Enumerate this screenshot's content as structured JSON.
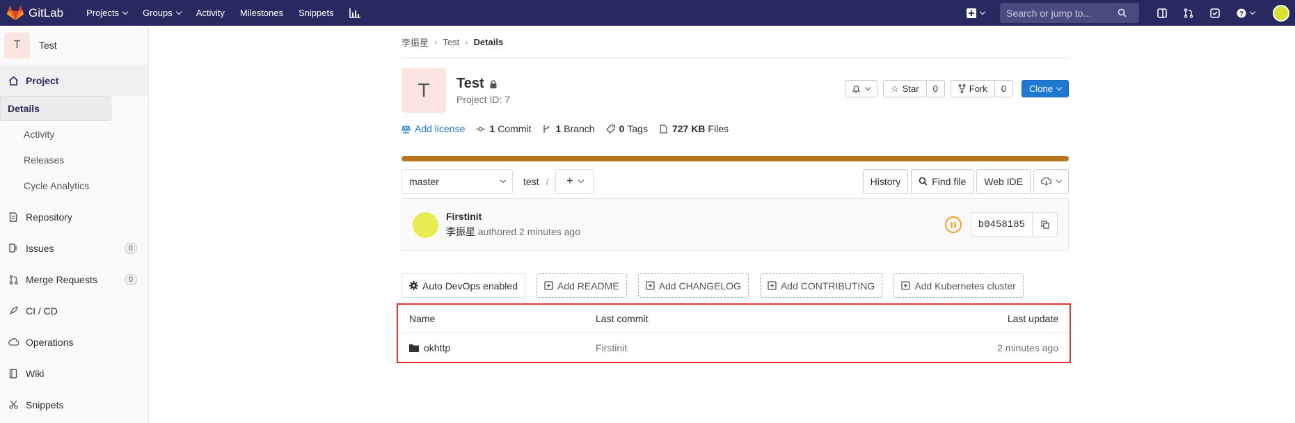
{
  "topbar": {
    "brand": "GitLab",
    "nav": [
      {
        "label": "Projects",
        "caret": true
      },
      {
        "label": "Groups",
        "caret": true
      },
      {
        "label": "Activity",
        "caret": false
      },
      {
        "label": "Milestones",
        "caret": false
      },
      {
        "label": "Snippets",
        "caret": false
      }
    ],
    "search_placeholder": "Search or jump to...",
    "colors": {
      "bg": "#292961"
    }
  },
  "sidebar": {
    "project_initial": "T",
    "project_name": "Test",
    "project_label": "Project",
    "sub_items": [
      "Details",
      "Activity",
      "Releases",
      "Cycle Analytics"
    ],
    "items": [
      {
        "label": "Repository",
        "icon": "repository-icon"
      },
      {
        "label": "Issues",
        "icon": "issues-icon",
        "count": "0"
      },
      {
        "label": "Merge Requests",
        "icon": "merge-request-icon",
        "count": "0"
      },
      {
        "label": "CI / CD",
        "icon": "rocket-icon"
      },
      {
        "label": "Operations",
        "icon": "cloud-gear-icon"
      },
      {
        "label": "Wiki",
        "icon": "book-icon"
      },
      {
        "label": "Snippets",
        "icon": "scissors-icon"
      }
    ]
  },
  "breadcrumb": {
    "owner": "李振星",
    "project": "Test",
    "current": "Details"
  },
  "project": {
    "initial": "T",
    "name": "Test",
    "id_text": "Project ID: 7",
    "star_label": "Star",
    "star_count": "0",
    "fork_label": "Fork",
    "fork_count": "0",
    "clone_label": "Clone"
  },
  "stats": {
    "add_license": "Add license",
    "commits_n": "1",
    "commits_label": "Commit",
    "branches_n": "1",
    "branches_label": "Branch",
    "tags_n": "0",
    "tags_label": "Tags",
    "files_size": "727 KB",
    "files_label": "Files",
    "language_bar_color": "#b8761d"
  },
  "toolbar": {
    "branch": "master",
    "path": "test",
    "history": "History",
    "find_file": "Find file",
    "web_ide": "Web IDE"
  },
  "commit": {
    "title": "Firstinit",
    "author": "李振星",
    "authored_text": "authored 2 minutes ago",
    "sha": "b0458185",
    "pipeline_status_color": "#f0a020"
  },
  "quick_actions": [
    "Auto DevOps enabled",
    "Add README",
    "Add CHANGELOG",
    "Add CONTRIBUTING",
    "Add Kubernetes cluster"
  ],
  "tree": {
    "headers": {
      "name": "Name",
      "last_commit": "Last commit",
      "last_update": "Last update"
    },
    "rows": [
      {
        "name": "okhttp",
        "last_commit": "Firstinit",
        "last_update": "2 minutes ago"
      }
    ]
  }
}
